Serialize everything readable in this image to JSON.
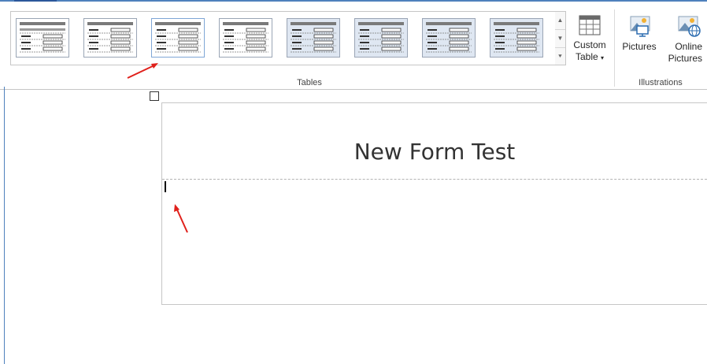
{
  "ribbon": {
    "gallery_items": [
      {
        "name": "table-style-1",
        "selected": false
      },
      {
        "name": "table-style-2",
        "selected": false
      },
      {
        "name": "table-style-3",
        "selected": true
      },
      {
        "name": "table-style-4",
        "selected": false
      },
      {
        "name": "table-style-5",
        "selected": false
      },
      {
        "name": "table-style-6",
        "selected": false
      },
      {
        "name": "table-style-7",
        "selected": false
      },
      {
        "name": "table-style-8",
        "selected": false
      }
    ],
    "custom_table_label_line1": "Custom",
    "custom_table_label_line2": "Table",
    "pictures_label": "Pictures",
    "online_pictures_line1": "Online",
    "online_pictures_line2": "Pictures",
    "tables_group_label": "Tables",
    "illustrations_group_label": "Illustrations",
    "scroll_up_glyph": "▲",
    "scroll_down_glyph": "▼",
    "scroll_more_glyph": "⯆"
  },
  "document": {
    "title": "New Form Test"
  },
  "colors": {
    "accent": "#2b579a",
    "annotation_arrow": "#e0201b"
  }
}
